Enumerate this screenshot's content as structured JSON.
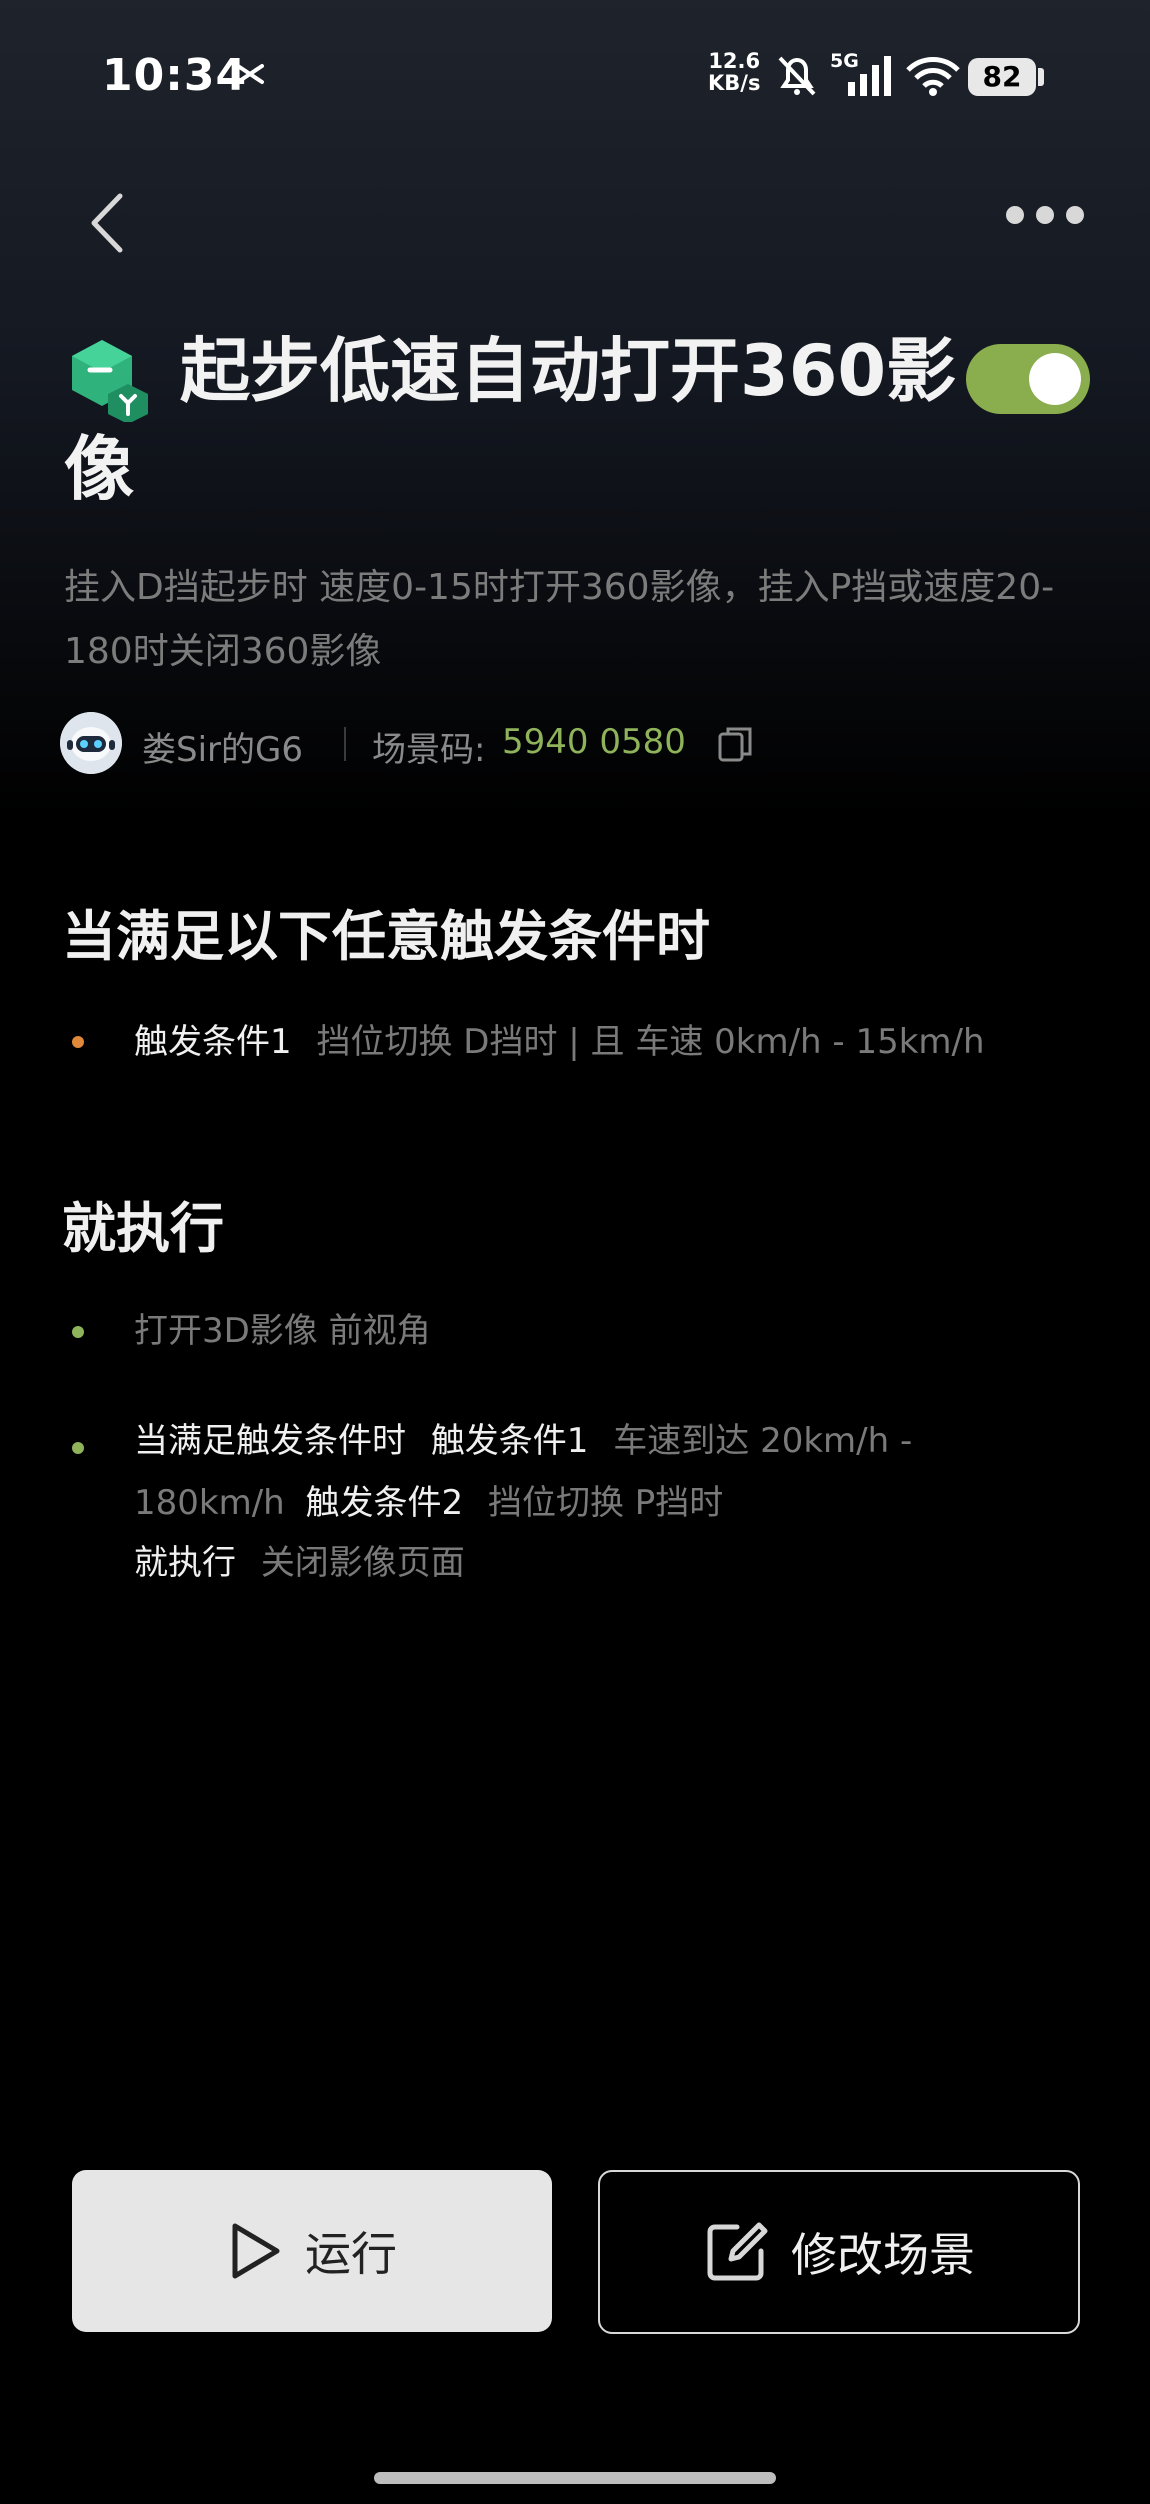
{
  "status_bar": {
    "time": "10:34",
    "net_speed_value": "12.6",
    "net_speed_unit": "KB/s",
    "signal_label": "5G",
    "battery": "82"
  },
  "scene": {
    "title": "起步低速自动打开360影像",
    "enabled": true,
    "description": "挂入D挡起步时 速度0-15时打开360影像，挂入P挡或速度20-180时关闭360影像",
    "author": "娄Sir的G6",
    "code_label": "场景码:",
    "code_value": "5940 0580"
  },
  "trigger_section": {
    "heading": "当满足以下任意触发条件时",
    "items": [
      {
        "name": "触发条件1",
        "detail": "挡位切换 D挡时 | 且 车速 0km/h - 15km/h"
      }
    ]
  },
  "action_section": {
    "heading": "就执行",
    "item1": "打开3D影像 前视角",
    "item2": {
      "prefix": "当满足触发条件时",
      "cond1_name": "触发条件1",
      "cond1_detail_a": "车速到达 20km/h -",
      "cond1_detail_b": "180km/h",
      "cond2_name": "触发条件2",
      "cond2_detail": "挡位切换 P挡时",
      "then_label": "就执行",
      "then_detail": "关闭影像页面"
    }
  },
  "buttons": {
    "run": "运行",
    "edit": "修改场景"
  },
  "colors": {
    "accent_green": "#8fb35a",
    "toggle_on": "#8aad4e",
    "trigger_dot": "#e0893a",
    "action_dot": "#8fb35a"
  }
}
